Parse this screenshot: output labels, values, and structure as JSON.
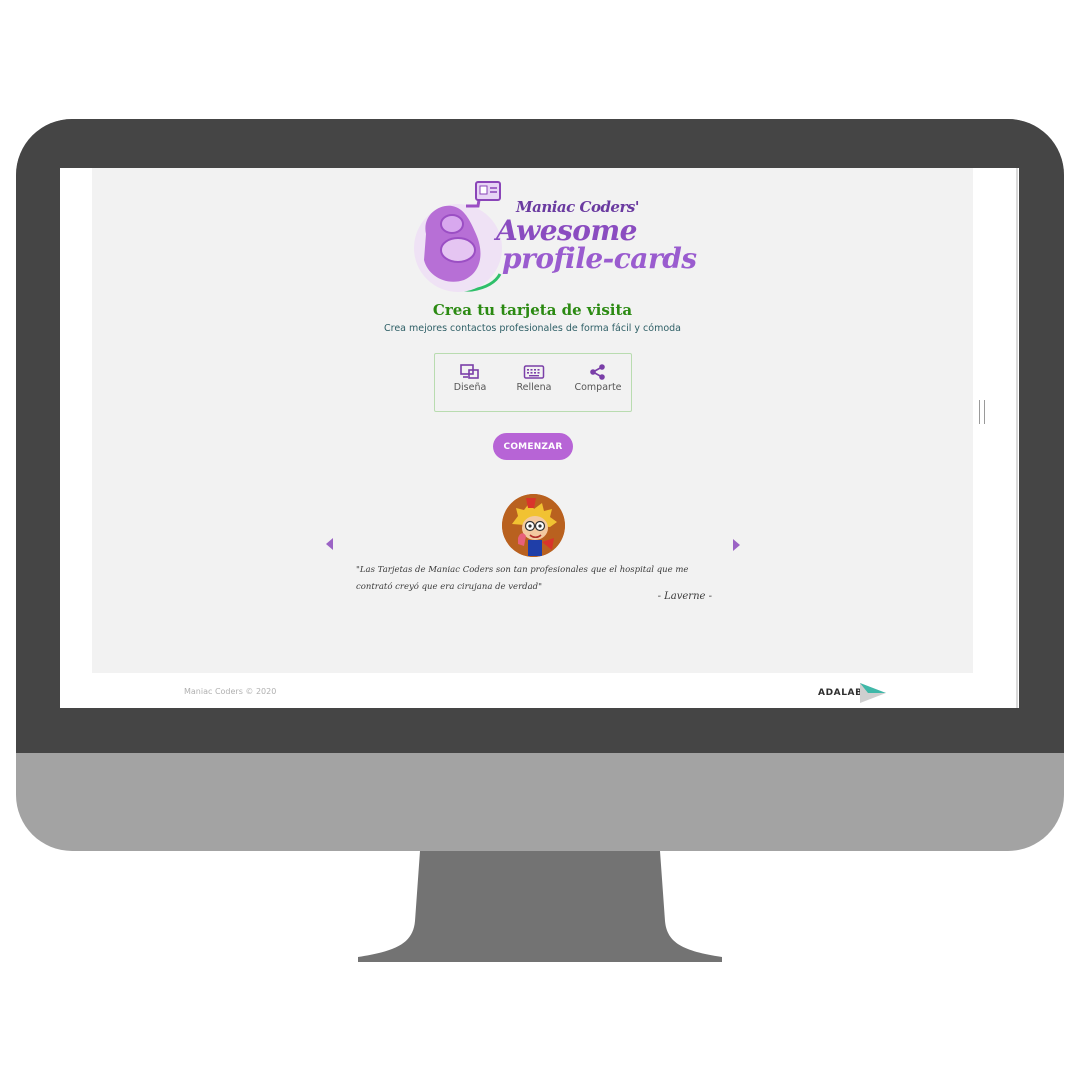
{
  "logo": {
    "line1": "Maniac Coders'",
    "line2": "Awesome",
    "line3": "profile-cards"
  },
  "hero": {
    "title": "Crea tu tarjeta de visita",
    "subtitle": "Crea mejores contactos profesionales de forma fácil y cómoda"
  },
  "steps": [
    {
      "label": "Diseña",
      "icon": "design-icon"
    },
    {
      "label": "Rellena",
      "icon": "keyboard-icon"
    },
    {
      "label": "Comparte",
      "icon": "share-icon"
    }
  ],
  "cta": {
    "label": "COMENZAR"
  },
  "testimonial": {
    "quote": "\"Las Tarjetas de Maniac Coders son tan profesionales que el hospital que me contrató creyó que era cirujana de verdad\"",
    "author": "- Laverne -"
  },
  "footer": {
    "copyright": "Maniac Coders © 2020",
    "brand": "ADALAB"
  },
  "colors": {
    "accent": "#b764d6",
    "title_green": "#2b8a12",
    "page_bg": "#f2f2f2",
    "monitor_dark": "#454545",
    "monitor_light": "#a3a3a3"
  }
}
